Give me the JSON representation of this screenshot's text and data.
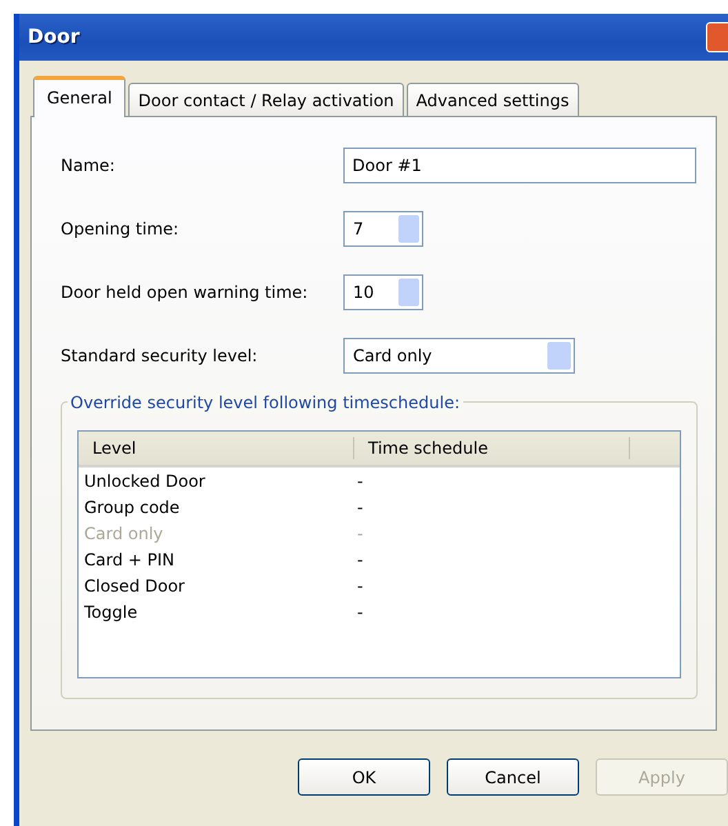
{
  "window": {
    "title": "Door"
  },
  "tabs": [
    {
      "label": "General",
      "selected": true
    },
    {
      "label": "Door contact / Relay activation",
      "selected": false
    },
    {
      "label": "Advanced settings",
      "selected": false
    }
  ],
  "fields": [
    {
      "kind": "text",
      "label": "Name:",
      "value": "Door #1"
    },
    {
      "kind": "spinner",
      "label": "Opening time:",
      "value": "7"
    },
    {
      "kind": "spinner",
      "label": "Door held open warning time:",
      "value": "10"
    },
    {
      "kind": "dropdown",
      "label": "Standard security level:",
      "value": "Card only"
    }
  ],
  "override_group": {
    "title": "Override security level following timeschedule:",
    "columns": [
      "Level",
      "Time schedule"
    ],
    "rows": [
      {
        "level": "Unlocked Door",
        "time_schedule": "-",
        "disabled": false
      },
      {
        "level": "Group code",
        "time_schedule": "-",
        "disabled": false
      },
      {
        "level": "Card only",
        "time_schedule": "-",
        "disabled": true
      },
      {
        "level": "Card + PIN",
        "time_schedule": "-",
        "disabled": false
      },
      {
        "level": "Closed Door",
        "time_schedule": "-",
        "disabled": false
      },
      {
        "level": "Toggle",
        "time_schedule": "-",
        "disabled": false
      }
    ]
  },
  "buttons": [
    {
      "label": "OK",
      "disabled": false
    },
    {
      "label": "Cancel",
      "disabled": false
    },
    {
      "label": "Apply",
      "disabled": true
    }
  ]
}
